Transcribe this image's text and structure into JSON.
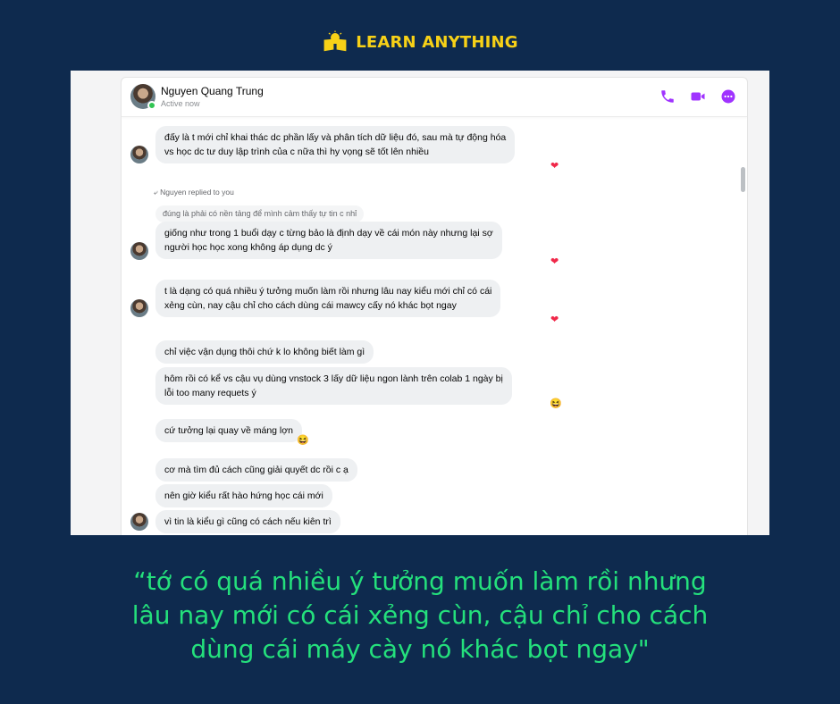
{
  "brand": {
    "name": "LEARN ANYTHING",
    "color": "#f7d117",
    "logo_icon": "book-bulb-icon"
  },
  "header": {
    "name": "Nguyen Quang Trung",
    "status": "Active now",
    "actions": [
      "phone-icon",
      "video-icon",
      "more-icon"
    ],
    "accent": "#a033ff"
  },
  "messages": {
    "m1": {
      "line1": "đấy là t mới chỉ khai thác dc phần lấy và phân tích dữ liệu đó, sau mà tự động hóa",
      "line2": "vs học dc tư duy lập trình của c nữa thì hy vọng sẽ tốt lên nhiều",
      "reaction": "❤"
    },
    "reply_label": "Nguyen replied to you",
    "quoted": "đúng là phải có nền tảng để  mình cảm thấy tự tin c nhỉ",
    "m2": {
      "line1": "giống như trong 1 buổi dạy c từng bảo là định dạy về cái món này nhưng lại sợ",
      "line2": "người học học xong không áp dụng dc ý",
      "reaction": "❤"
    },
    "m3": {
      "line1": "t là dạng có quá nhiều ý tưởng muốn làm rồi nhưng lâu nay kiểu mới chỉ có cái",
      "line2": "xẻng cùn, nay cậu chỉ cho cách dùng cái mawcy cấy nó khác bọt ngay",
      "reaction": "❤"
    },
    "m4": "chỉ việc vận dụng thôi chứ k lo không biết làm gì",
    "m5": {
      "line1": "hôm rồi có kể vs cậu vụ dùng vnstock 3 lấy dữ liệu ngon lành trên colab 1 ngày bị",
      "line2": "lỗi too many requets ý",
      "reaction": "😆"
    },
    "m6": {
      "text": "cứ tưởng lại quay về máng lợn",
      "reaction": "😆"
    },
    "m7": "cơ mà tìm đủ cách cũng giải quyết dc rồi c ạ",
    "m8": "nên giờ kiểu rất hào hứng học cái mới",
    "m9": "vì tin là kiểu gì cũng có cách nếu kiên trì"
  },
  "quote": {
    "line1": "“tớ có quá nhiều ý tưởng muốn làm rồi nhưng",
    "line2": "lâu nay mới có cái xẻng cùn, cậu chỉ cho cách",
    "line3": "dùng cái máy cày nó khác bọt ngay\"",
    "color": "#24e07c"
  },
  "colors": {
    "background": "#0e2a4e",
    "bubble": "#eef0f2",
    "heart": "#f02849"
  }
}
